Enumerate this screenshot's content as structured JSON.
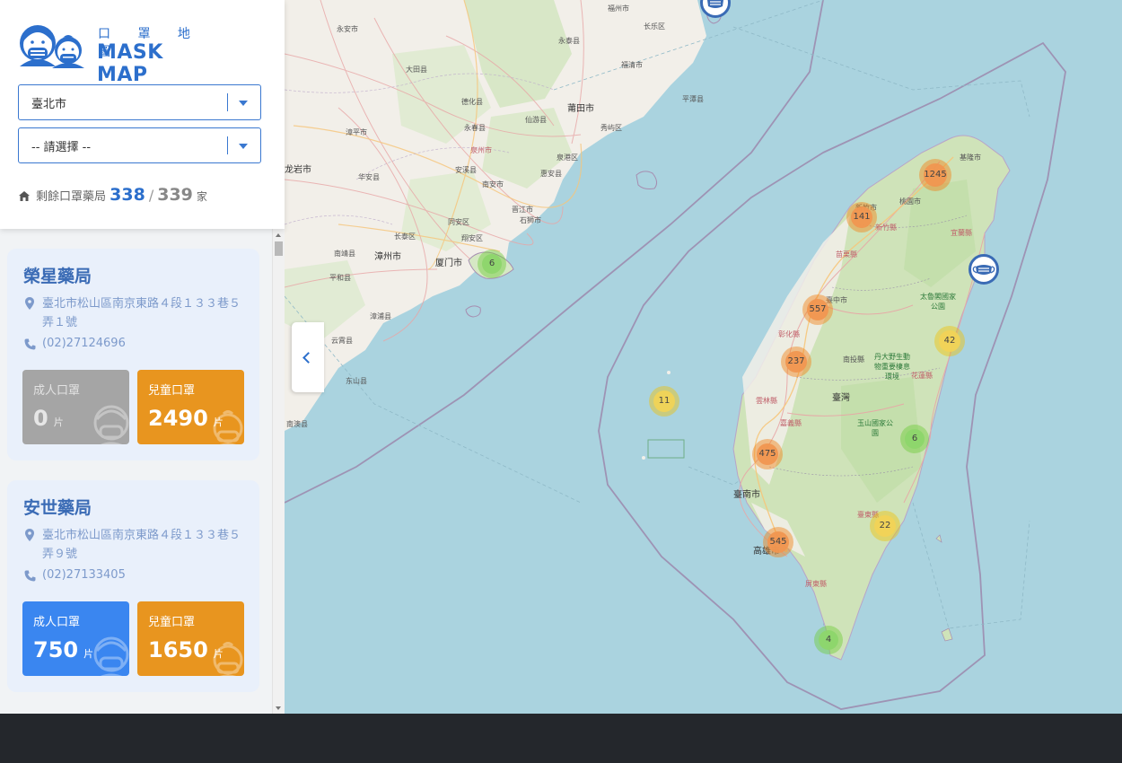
{
  "logo": {
    "subtitle": "口 罩 地 圖",
    "title": "MASK MAP"
  },
  "filters": {
    "city": "臺北市",
    "district": "-- 請選擇 --"
  },
  "summary": {
    "label": "剩餘口罩藥局",
    "available": "338",
    "separator": "/",
    "total": "339",
    "unit": "家"
  },
  "pharmacies": [
    {
      "name": "榮星藥局",
      "address": "臺北市松山區南京東路４段１３３巷５弄１號",
      "phone": "(02)27124696",
      "adult_label": "成人口罩",
      "adult_count": "0",
      "child_label": "兒童口罩",
      "child_count": "2490",
      "unit": "片",
      "adult_status": "empty"
    },
    {
      "name": "安世藥局",
      "address": "臺北市松山區南京東路４段１３３巷５弄９號",
      "phone": "(02)27133405",
      "adult_label": "成人口罩",
      "adult_count": "750",
      "child_label": "兒童口罩",
      "child_count": "1650",
      "unit": "片",
      "adult_status": "available"
    }
  ],
  "map": {
    "clusters": [
      {
        "count": "1245",
        "level": "orange"
      },
      {
        "count": "141",
        "level": "orange"
      },
      {
        "count": "557",
        "level": "orange"
      },
      {
        "count": "237",
        "level": "orange"
      },
      {
        "count": "475",
        "level": "orange"
      },
      {
        "count": "545",
        "level": "orange"
      },
      {
        "count": "42",
        "level": "yellow"
      },
      {
        "count": "22",
        "level": "yellow"
      },
      {
        "count": "11",
        "level": "yellow"
      },
      {
        "count": "6",
        "level": "green"
      },
      {
        "count": "6",
        "level": "green"
      },
      {
        "count": "4",
        "level": "green"
      }
    ],
    "labels": [
      "福州市",
      "永泰县",
      "长乐区",
      "福清市",
      "平潭县",
      "大田县",
      "德化县",
      "仙游县",
      "莆田市",
      "秀屿区",
      "漳平市",
      "永春县",
      "泉州市",
      "泉港区",
      "惠安县",
      "华安县",
      "南安市",
      "安溪县",
      "晋江市",
      "石狮市",
      "龙岩市",
      "长泰区",
      "漳州市",
      "厦门市",
      "同安区",
      "翔安区",
      "南靖县",
      "平和县",
      "漳浦县",
      "云霄县",
      "东山县",
      "南澳县",
      "基隆市",
      "宜蘭縣",
      "新竹縣",
      "新竹市",
      "苗栗縣",
      "臺中市",
      "彰化縣",
      "南投縣",
      "雲林縣",
      "嘉義縣",
      "臺南市",
      "高雄市",
      "屏東縣",
      "臺東縣",
      "花蓮縣",
      "臺灣",
      "桃園市",
      "太魯閣國家公園",
      "丹大野生動物重要棲息環境",
      "玉山國家公園",
      "永安市",
      "泉州市"
    ]
  },
  "colors": {
    "brand": "#2c6fcc",
    "orange_tile": "#e8951f",
    "blue_tile": "#3a86f0",
    "gray_tile": "#a5a5a5",
    "sea": "#aad3df"
  }
}
